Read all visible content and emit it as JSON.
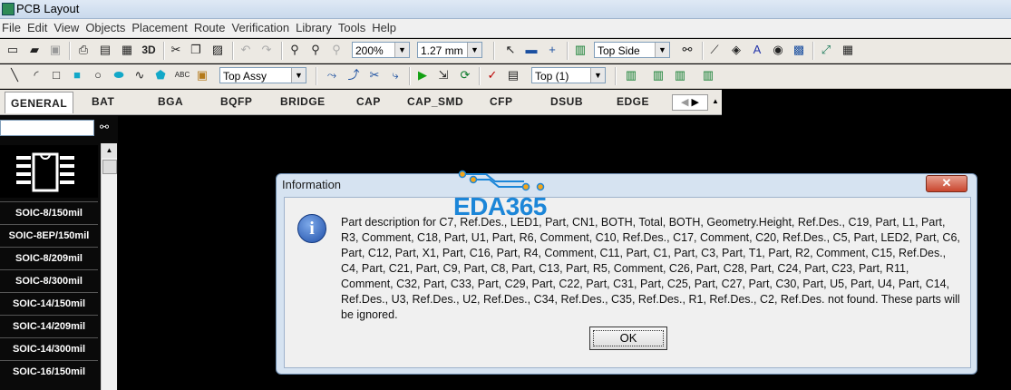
{
  "window": {
    "title": "PCB Layout"
  },
  "menu": [
    "File",
    "Edit",
    "View",
    "Objects",
    "Placement",
    "Route",
    "Verification",
    "Library",
    "Tools",
    "Help"
  ],
  "toolbar1": {
    "zoom_value": "200%",
    "grid_value": "1.27 mm",
    "side_value": "Top Side",
    "btn_3d": "3D"
  },
  "toolbar2": {
    "assy_value": "Top Assy",
    "layer_value": "Top (1)",
    "text_tool": "ABC"
  },
  "library_tabs": [
    "GENERAL",
    "BAT",
    "BGA",
    "BQFP",
    "BRIDGE",
    "CAP",
    "CAP_SMD",
    "CFP",
    "DSUB",
    "EDGE"
  ],
  "library_items": [
    "SOIC-8/150mil",
    "SOIC-8EP/150mil",
    "SOIC-8/209mil",
    "SOIC-8/300mil",
    "SOIC-14/150mil",
    "SOIC-14/209mil",
    "SOIC-14/300mil",
    "SOIC-16/150mil"
  ],
  "dialog": {
    "title": "Information",
    "close_label": "✕",
    "message": "Part description for C7, Ref.Des., LED1, Part, CN1, BOTH, Total, BOTH, Geometry.Height, Ref.Des., C19, Part, L1, Part, R3, Comment, C18, Part, U1, Part, R6, Comment, C10, Ref.Des., C17, Comment, C20, Ref.Des., C5, Part, LED2, Part, C6, Part, C12, Part, X1, Part, C16, Part, R4, Comment, C11, Part, C1, Part, C3, Part, T1, Part, R2, Comment, C15, Ref.Des., C4, Part, C21, Part, C9, Part, C8, Part, C13, Part, R5, Comment, C26, Part, C28, Part, C24, Part, C23, Part, R11, Comment, C32, Part, C33, Part, C29, Part, C22, Part, C31, Part, C25, Part, C27, Part, C30, Part, U5, Part, U4, Part, C14, Ref.Des., U3, Ref.Des., U2, Ref.Des., C34, Ref.Des., C35, Ref.Des., R1, Ref.Des., C2, Ref.Des. not found. These parts will be ignored.",
    "ok_label": "OK",
    "icon": "info-icon"
  },
  "watermark": {
    "text": "EDA365"
  },
  "colors": {
    "canvas": "#000000",
    "accent": "#1c86d8",
    "dialog_frame": "#d6e3f1"
  }
}
